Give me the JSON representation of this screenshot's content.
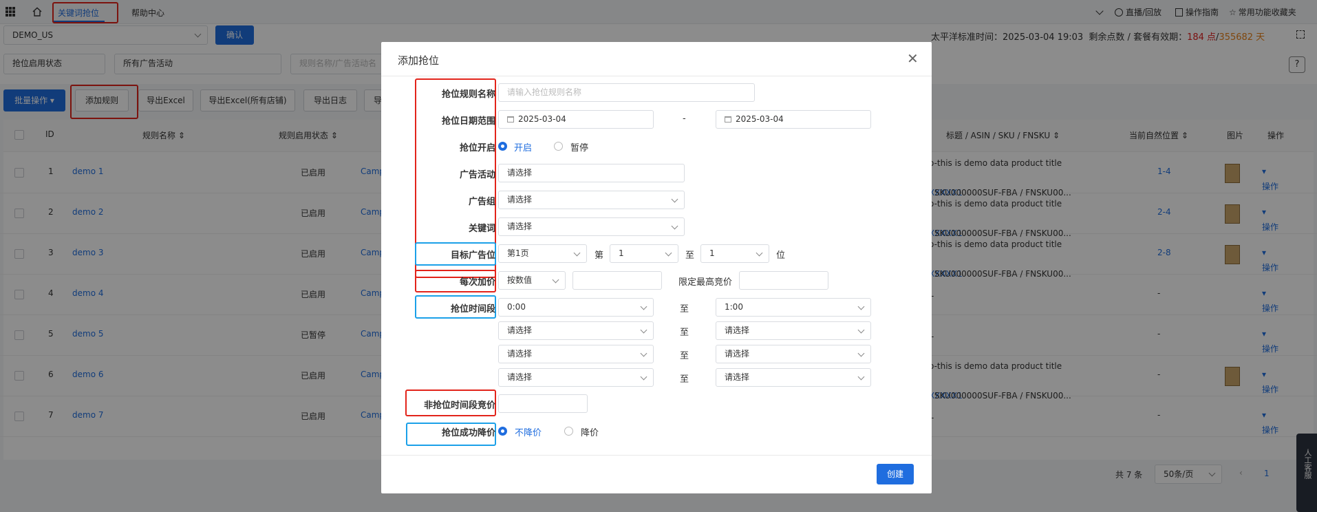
{
  "tabs": [
    "关键词抢位",
    "帮助中心"
  ],
  "top_right": {
    "live": "直播/回放",
    "guide": "操作指南",
    "fav": "常用功能收藏夹"
  },
  "store": {
    "value": "DEMO_US",
    "confirm": "确认"
  },
  "time_info": {
    "label": "太平洋标准时间：2025-03-04 19:03",
    "points_label": "剩余点数 / 套餐有效期：",
    "points": "184 点",
    "sep": "/",
    "days": "355682 天"
  },
  "filters": {
    "status": "抢位启用状态",
    "campaign": "所有广告活动",
    "search_placeholder": "规则名称/广告活动名"
  },
  "toolbar": {
    "batch": "批量操作",
    "add_rule": "添加规则",
    "export_excel": "导出Excel",
    "export_all": "导出Excel(所有店铺)",
    "export_log": "导出日志",
    "more": "导"
  },
  "table": {
    "headers": {
      "id": "ID",
      "name": "规则名称",
      "status": "规则启用状态",
      "product": "标题 / ASIN / SKU / FNSKU",
      "position": "当前自然位置",
      "image": "图片",
      "ops": "操作"
    },
    "rows": [
      {
        "id": "1",
        "name": "demo 1",
        "status": "已启用",
        "campaign": "Camp",
        "title": "o-this is demo data product title",
        "asin": "XXXXX1",
        "sku": " / SKU000000SUF-FBA / FNSKU00...",
        "pos": "1-4",
        "op": "操作"
      },
      {
        "id": "2",
        "name": "demo 2",
        "status": "已启用",
        "campaign": "Camp",
        "title": "o-this is demo data product title",
        "asin": "XXXXX1",
        "sku": " / SKU000000SUF-FBA / FNSKU00...",
        "pos": "2-4",
        "op": "操作"
      },
      {
        "id": "3",
        "name": "demo 3",
        "status": "已启用",
        "campaign": "Camp",
        "title": "o-this is demo data product title",
        "asin": "XXXXX1",
        "sku": " / SKU000000SUF-FBA / FNSKU00...",
        "pos": "2-8",
        "op": "操作"
      },
      {
        "id": "4",
        "name": "demo 4",
        "status": "已启用",
        "campaign": "Camp",
        "title": "-",
        "asin": "",
        "sku": "",
        "pos": "-",
        "op": "操作"
      },
      {
        "id": "5",
        "name": "demo 5",
        "status": "已暂停",
        "campaign": "Camp",
        "title": "-",
        "asin": "",
        "sku": "",
        "pos": "-",
        "op": "操作"
      },
      {
        "id": "6",
        "name": "demo 6",
        "status": "已启用",
        "campaign": "Camp",
        "title": "o-this is demo data product title",
        "asin": "XXXXX1",
        "sku": " / SKU000000SUF-FBA / FNSKU00...",
        "pos": "-",
        "op": "操作"
      },
      {
        "id": "7",
        "name": "demo 7",
        "status": "已启用",
        "campaign": "Camp",
        "title": "-",
        "asin": "",
        "sku": "",
        "pos": "-",
        "op": "操作"
      }
    ]
  },
  "pagination": {
    "total": "共 7 条",
    "page_size": "50条/页",
    "page": "1"
  },
  "service": "人工客服",
  "modal": {
    "title": "添加抢位",
    "labels": {
      "rule_name": "抢位规则名称",
      "date_range": "抢位日期范围",
      "enable": "抢位开启",
      "campaign": "广告活动",
      "ad_group": "广告组",
      "keyword": "关键词",
      "target_pos": "目标广告位",
      "bid_step": "每次加价",
      "time_slot": "抢位时间段",
      "non_slot_bid": "非抢位时间段竞价",
      "success_drop": "抢位成功降价"
    },
    "rule_name_placeholder": "请输入抢位规则名称",
    "date_start": "2025-03-04",
    "date_sep": "-",
    "date_end": "2025-03-04",
    "enable_on": "开启",
    "enable_off": "暂停",
    "select_placeholder": "请选择",
    "page_sel": "第1页",
    "pos_di": "第",
    "pos_from": "1",
    "pos_to_word": "至",
    "pos_to": "1",
    "pos_unit": "位",
    "bid_mode": "按数值",
    "max_bid_label": "限定最高竞价",
    "slot_to": "至",
    "slot1_start": "0:00",
    "slot1_end": "1:00",
    "drop_no": "不降价",
    "drop_yes": "降价",
    "create": "创建"
  },
  "colors": {
    "primary": "#1f6ddf",
    "red_box": "#e2231a",
    "blue_box": "#1aa0e8",
    "points": "#e02020",
    "days": "#e8811a"
  }
}
